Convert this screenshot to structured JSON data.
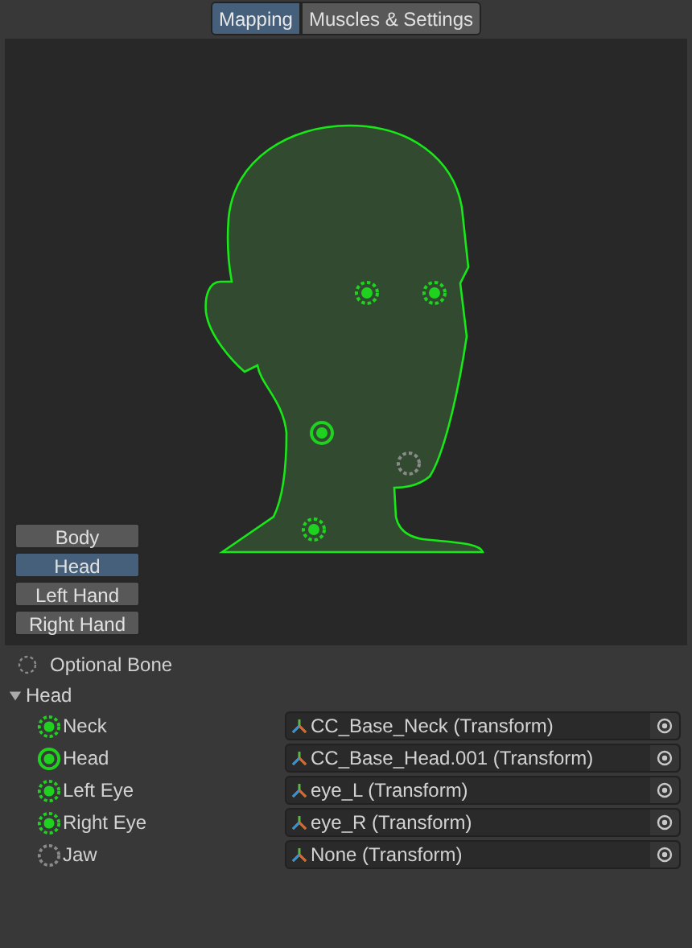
{
  "tabs": [
    {
      "label": "Mapping",
      "selected": true
    },
    {
      "label": "Muscles & Settings",
      "selected": false
    }
  ],
  "views": [
    {
      "label": "Body",
      "selected": false
    },
    {
      "label": "Head",
      "selected": true
    },
    {
      "label": "Left Hand",
      "selected": false
    },
    {
      "label": "Right Hand",
      "selected": false
    }
  ],
  "legend": {
    "label": "Optional Bone"
  },
  "group": {
    "label": "Head",
    "expanded": true,
    "bones": [
      {
        "name": "Neck",
        "kind": "optional",
        "mapped": true,
        "value": "CC_Base_Neck (Transform)"
      },
      {
        "name": "Head",
        "kind": "required",
        "mapped": true,
        "value": "CC_Base_Head.001 (Transform)"
      },
      {
        "name": "Left Eye",
        "kind": "optional",
        "mapped": true,
        "value": "eye_L (Transform)"
      },
      {
        "name": "Right Eye",
        "kind": "optional",
        "mapped": true,
        "value": "eye_R (Transform)"
      },
      {
        "name": "Jaw",
        "kind": "optional",
        "mapped": false,
        "value": "None (Transform)"
      }
    ]
  }
}
